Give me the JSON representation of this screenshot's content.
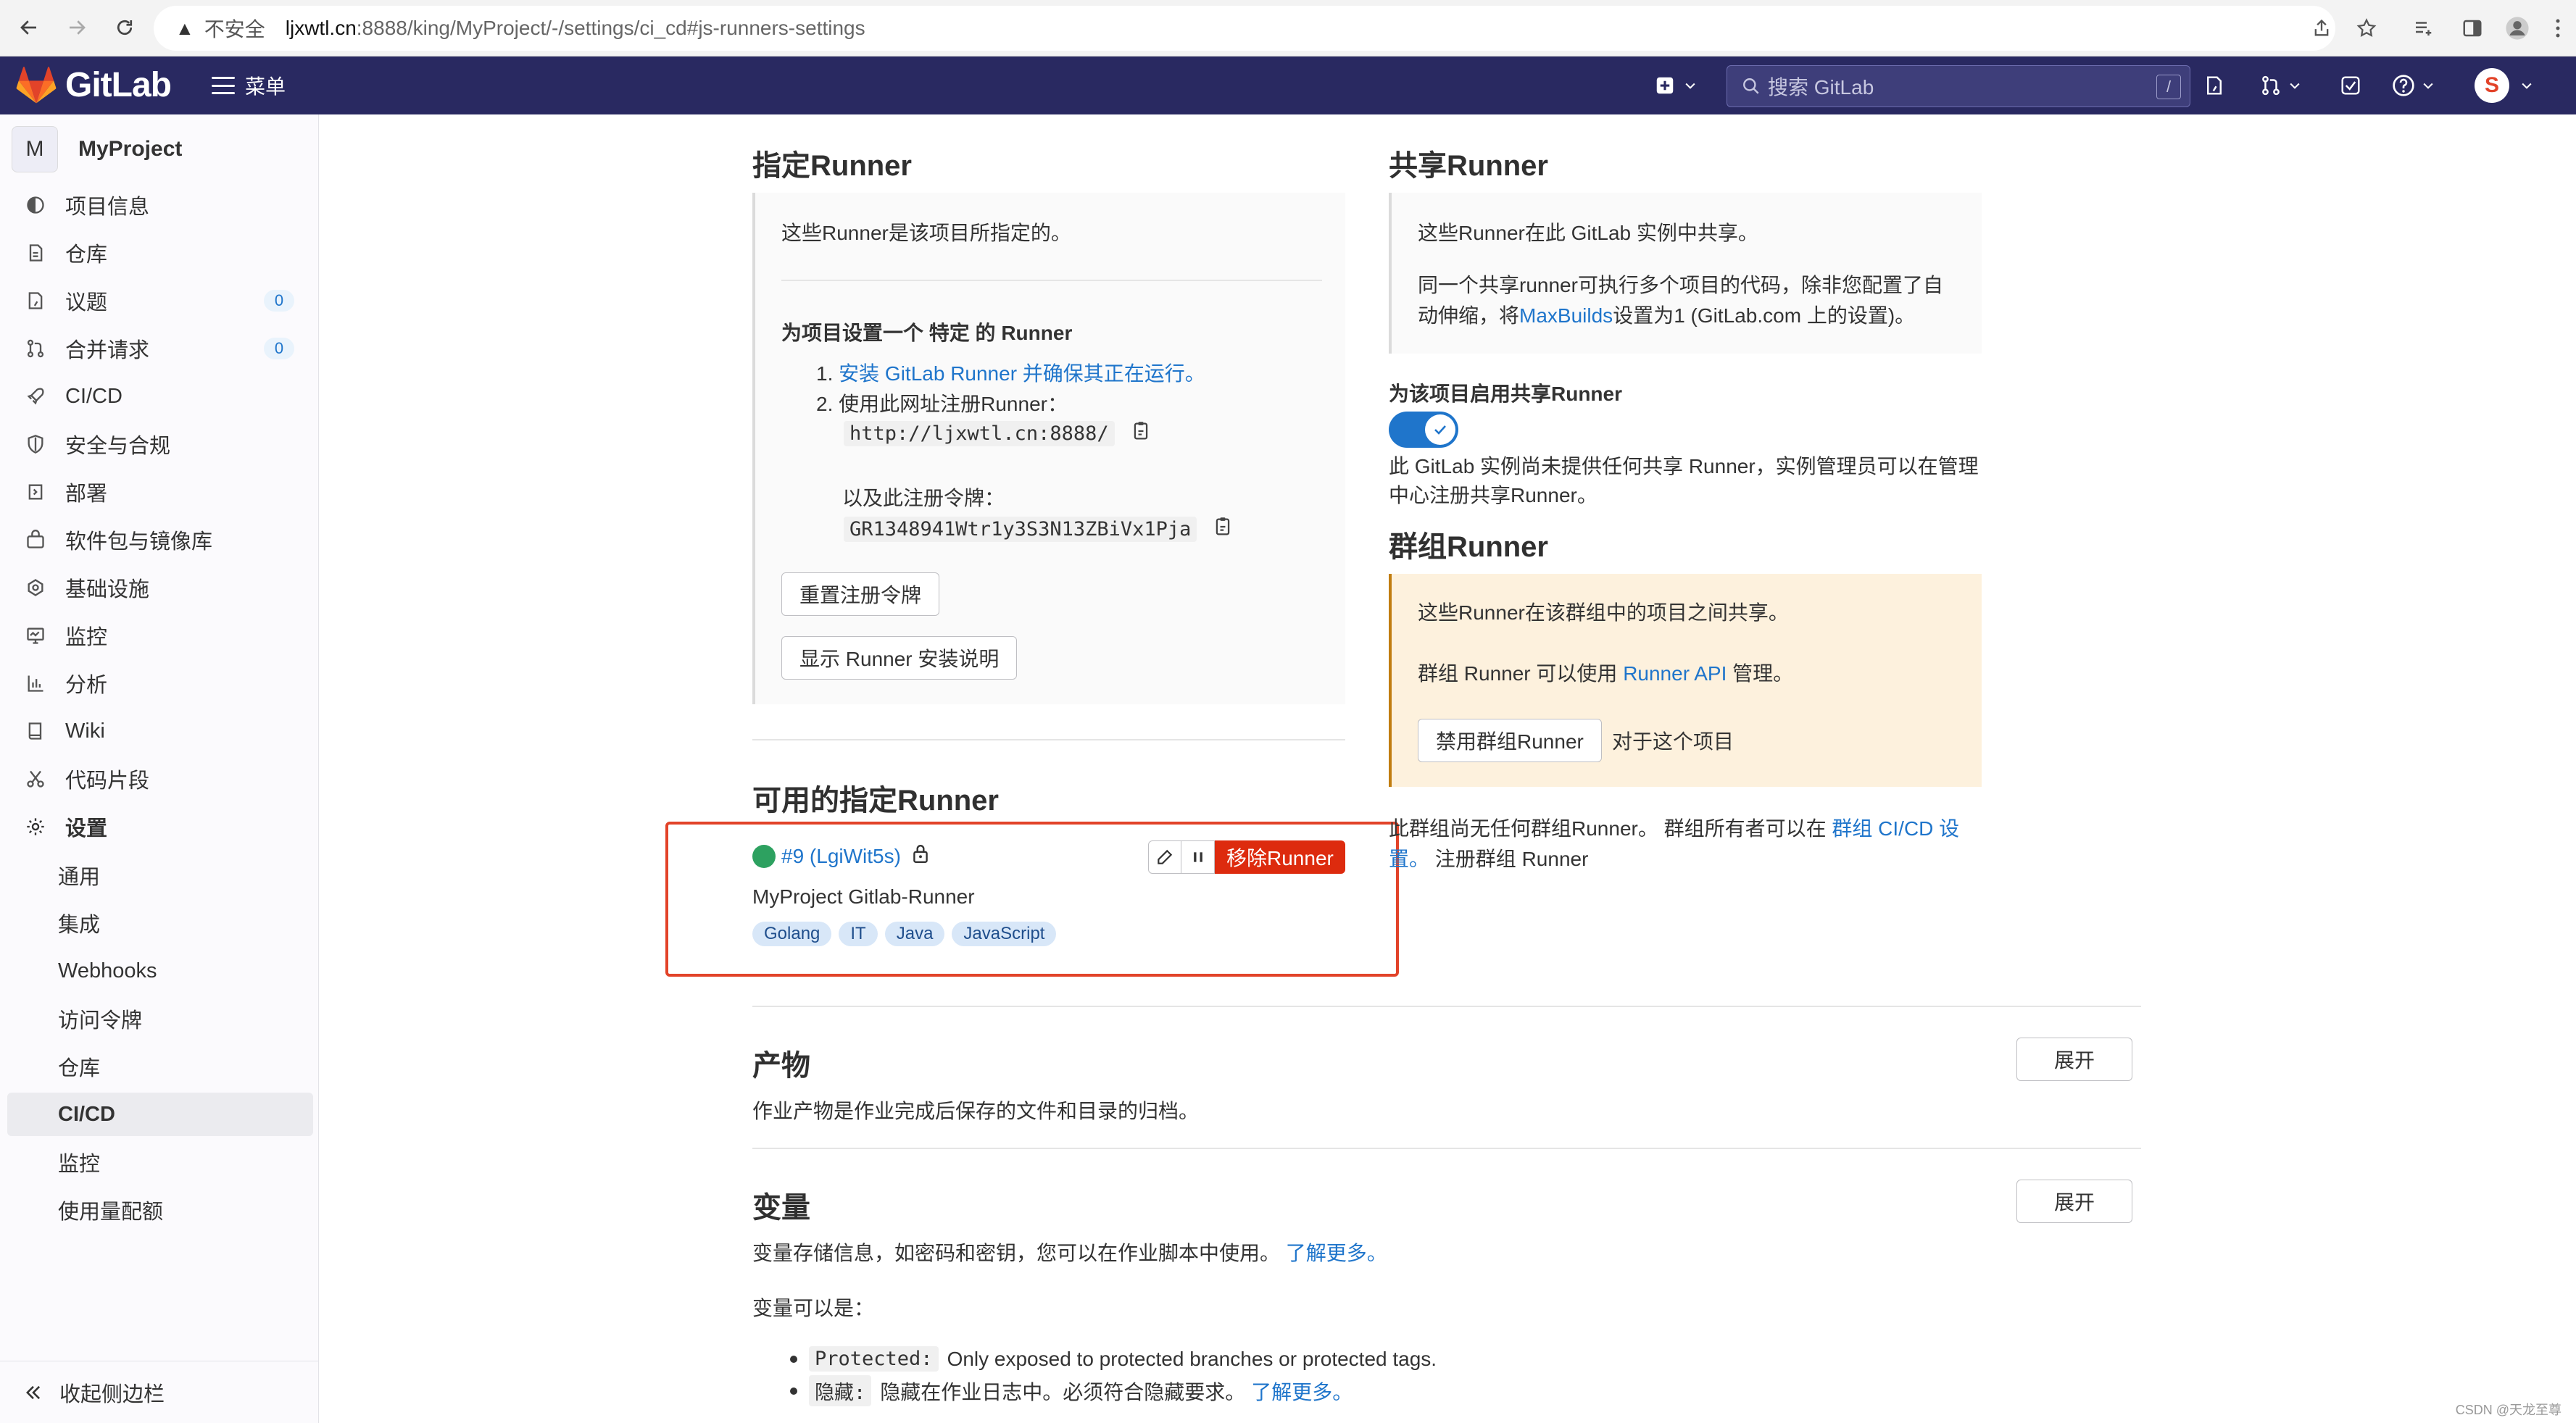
{
  "browser": {
    "insecure_label": "不安全",
    "url_host": "ljxwtl.cn",
    "url_path": ":8888/king/MyProject/-/settings/ci_cd#js-runners-settings"
  },
  "topnav": {
    "logo_text": "GitLab",
    "menu_label": "菜单",
    "search_placeholder": "搜索 GitLab",
    "search_shortcut": "/",
    "avatar_letter": "S"
  },
  "sidebar": {
    "project_initial": "M",
    "project_name": "MyProject",
    "items": [
      {
        "label": "项目信息"
      },
      {
        "label": "仓库"
      },
      {
        "label": "议题",
        "badge": "0"
      },
      {
        "label": "合并请求",
        "badge": "0"
      },
      {
        "label": "CI/CD"
      },
      {
        "label": "安全与合规"
      },
      {
        "label": "部署"
      },
      {
        "label": "软件包与镜像库"
      },
      {
        "label": "基础设施"
      },
      {
        "label": "监控"
      },
      {
        "label": "分析"
      },
      {
        "label": "Wiki"
      },
      {
        "label": "代码片段"
      },
      {
        "label": "设置"
      }
    ],
    "sub_items": [
      {
        "label": "通用"
      },
      {
        "label": "集成"
      },
      {
        "label": "Webhooks"
      },
      {
        "label": "访问令牌"
      },
      {
        "label": "仓库"
      },
      {
        "label": "CI/CD"
      },
      {
        "label": "监控"
      },
      {
        "label": "使用量配额"
      }
    ],
    "collapse_label": "收起侧边栏"
  },
  "specific": {
    "title": "指定Runner",
    "intro": "这些Runner是该项目所指定的。",
    "setup_title": "为项目设置一个 特定 的 Runner",
    "step1_num": "1.",
    "step1_link": "安装 GitLab Runner 并确保其正在运行。",
    "step2_num": "2.",
    "step2_text": "使用此网址注册Runner：",
    "register_url": "http://ljxwtl.cn:8888/",
    "token_label": "以及此注册令牌：",
    "token": "GR1348941Wtr1y3S3N13ZBiVx1Pja",
    "reset_button": "重置注册令牌",
    "show_install_button": "显示 Runner 安装说明"
  },
  "available": {
    "title": "可用的指定Runner",
    "runner_id": "#9 (LgiWit5s)",
    "runner_name": "MyProject Gitlab-Runner",
    "remove_button": "移除Runner",
    "tags": [
      "Golang",
      "IT",
      "Java",
      "JavaScript"
    ],
    "status_color": "#2da160"
  },
  "shared": {
    "title": "共享Runner",
    "line1": "这些Runner在此 GitLab 实例中共享。",
    "line2a": "同一个共享runner可执行多个项目的代码，除非您配置了自",
    "line2b_pre": "动伸缩，将",
    "line2b_link": "MaxBuilds",
    "line2b_post": "设置为1 (GitLab.com 上的设置)。",
    "enable_label": "为该项目启用共享Runner",
    "note_a": "此 GitLab 实例尚未提供任何共享 Runner，实例管理员可以在管理",
    "note_b": "中心注册共享Runner。"
  },
  "group": {
    "title": "群组Runner",
    "line1": "这些Runner在该群组中的项目之间共享。",
    "line2_pre": "群组 Runner 可以使用",
    "line2_link": "Runner API",
    "line2_post": "管理。",
    "disable_button": "禁用群组Runner",
    "disable_suffix": "对于这个项目",
    "note_pre": "此群组尚无任何群组Runner。 群组所有者可以在",
    "note_link_a": "群组 CI/CD 设",
    "note_link_b": "置。",
    "note_post": "注册群组 Runner"
  },
  "artifacts": {
    "title": "产物",
    "desc": "作业产物是作业完成后保存的文件和目录的归档。",
    "expand": "展开"
  },
  "variables": {
    "title": "变量",
    "desc_pre": "变量存储信息，如密码和密钥，您可以在作业脚本中使用。",
    "desc_link": "了解更多。",
    "can_be": "变量可以是：",
    "b1_code": "Protected:",
    "b1_text": "Only exposed to protected branches or protected tags.",
    "b2_code": "隐藏:",
    "b2_text": "隐藏在作业日志中。必须符合隐藏要求。",
    "b2_link": "了解更多。",
    "expand": "展开"
  },
  "watermark": "CSDN @天龙至尊",
  "colors": {
    "nav_bg": "#292961",
    "link": "#1f75cb",
    "danger": "#dd2b0e",
    "highlight_box": "#e24329",
    "group_panel": "#fdf1dd"
  }
}
